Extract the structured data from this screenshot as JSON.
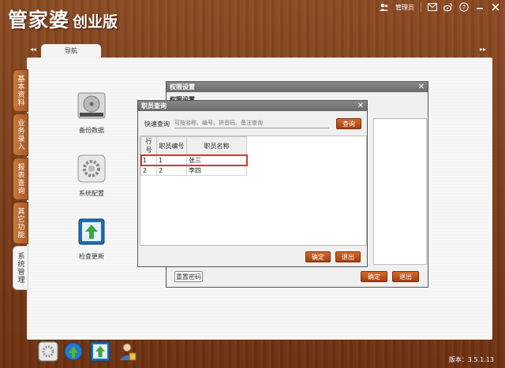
{
  "app": {
    "title_main": "管家婆",
    "title_edition": "创业版"
  },
  "topbar": {
    "user_label": "管理员"
  },
  "nav": {
    "tab_label": "导航",
    "prev": "◂◂",
    "next": "▸▸"
  },
  "sidebar": {
    "items": [
      {
        "label": "基本资料"
      },
      {
        "label": "业务录入"
      },
      {
        "label": "报表查询"
      },
      {
        "label": "其它功能"
      },
      {
        "label": "系统管理"
      }
    ]
  },
  "features": [
    {
      "label": "备份数据",
      "icon": "hard-drive-icon"
    },
    {
      "label": "系统配置",
      "icon": "gear-icon"
    },
    {
      "label": "检查更新",
      "icon": "update-icon"
    }
  ],
  "perm_dialog": {
    "title": "权限设置",
    "subtitle": "权限设置",
    "reset_label": "重置密码",
    "ok_label": "确定",
    "exit_label": "退出"
  },
  "staff_dialog": {
    "title": "职员查询",
    "search_label": "快速查询",
    "search_placeholder": "可按名称、编号、拼音码、备注查询",
    "query_label": "查询",
    "columns": [
      "行号",
      "职员编号",
      "职员名称"
    ],
    "rows": [
      {
        "row": "1",
        "code": "1",
        "name": "张三"
      },
      {
        "row": "2",
        "code": "2",
        "name": "李四"
      }
    ],
    "ok_label": "确定",
    "exit_label": "退出"
  },
  "footer": {
    "version": "版本：3.5.1.13"
  },
  "colors": {
    "accent": "#d04a10",
    "wood": "#7a3a16",
    "selection": "#e03030"
  }
}
